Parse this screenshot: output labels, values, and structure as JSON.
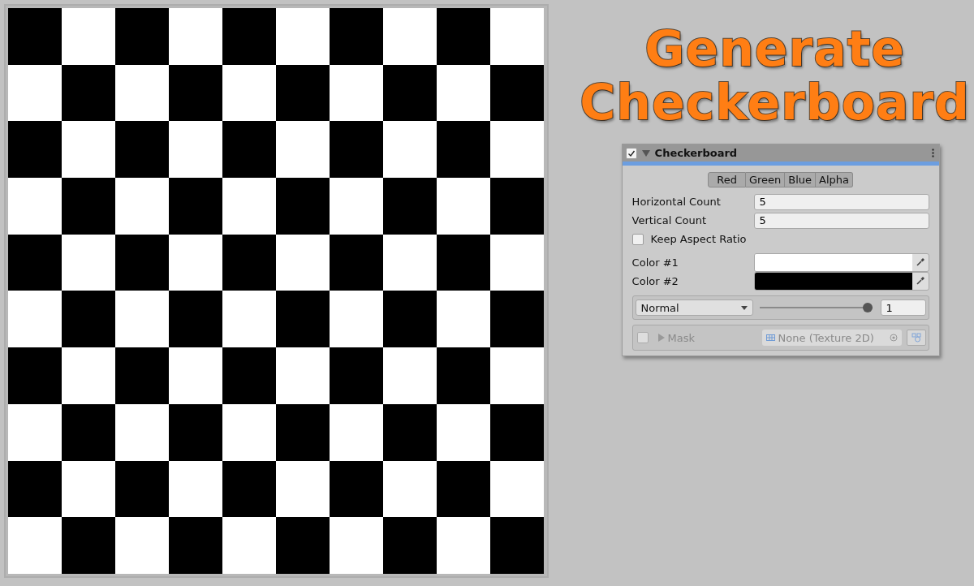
{
  "preview": {
    "kind": "checkerboard"
  },
  "title": {
    "line_1": "Generate",
    "line_2": "Checkerboard"
  },
  "component": {
    "enabled": true,
    "expanded": true,
    "name": "Checkerboard",
    "channels": [
      {
        "label": "Red",
        "selected": true
      },
      {
        "label": "Green",
        "selected": true
      },
      {
        "label": "Blue",
        "selected": true
      },
      {
        "label": "Alpha",
        "selected": true
      }
    ],
    "horizontal_count": {
      "label": "Horizontal Count",
      "value": "5"
    },
    "vertical_count": {
      "label": "Vertical Count",
      "value": "5"
    },
    "keep_aspect_ratio": {
      "label": "Keep Aspect Ratio",
      "checked": false
    },
    "colors": [
      {
        "label": "Color #1",
        "color": "#ffffff"
      },
      {
        "label": "Color #2",
        "color": "#000000"
      }
    ],
    "blend": {
      "mode": "Normal",
      "level": 1,
      "value": "1"
    },
    "mask": {
      "enabled": false,
      "label": "Mask",
      "texture": "None (Texture 2D)"
    }
  }
}
